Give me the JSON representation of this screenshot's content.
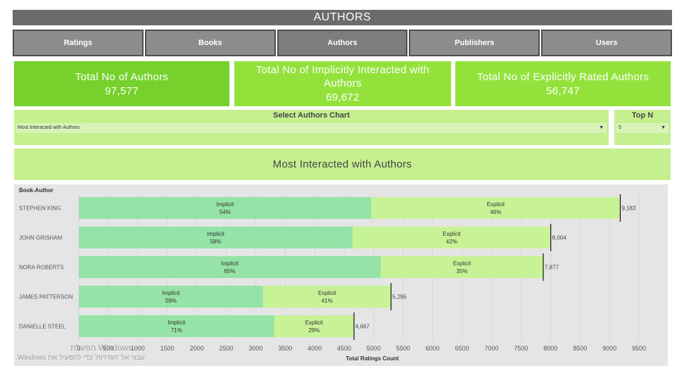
{
  "header": {
    "title": "AUTHORS"
  },
  "nav": {
    "tabs": [
      {
        "label": "Ratings"
      },
      {
        "label": "Books"
      },
      {
        "label": "Authors"
      },
      {
        "label": "Publishers"
      },
      {
        "label": "Users"
      }
    ]
  },
  "kpis": [
    {
      "label": "Total No of Authors",
      "value": "97,577"
    },
    {
      "label": "Total No of Implicitly Interacted with Authors",
      "value": "69,672"
    },
    {
      "label": "Total No of Explicitly Rated Authors",
      "value": "56,747"
    }
  ],
  "selector": {
    "label": "Select Authors Chart",
    "value": "Most Interacted with Authors"
  },
  "topn": {
    "label": "Top N",
    "value": "5"
  },
  "chart_title": "Most Interacted with Authors",
  "chart_data": {
    "type": "bar",
    "orientation": "horizontal",
    "stacked": true,
    "ylabel": "Book-Author",
    "xlabel": "Total Ratings Count",
    "categories": [
      "STEPHEN KING",
      "JOHN GRISHAM",
      "NORA ROBERTS",
      "JAMES PATTERSON",
      "DANIELLE STEEL"
    ],
    "totals": [
      9183,
      8004,
      7877,
      5295,
      4667
    ],
    "total_labels": [
      "9,183",
      "8,004",
      "7,877",
      "5,295",
      "4,667"
    ],
    "series": [
      {
        "name": "Implicit",
        "percent_labels": [
          "54%",
          "58%",
          "65%",
          "59%",
          "71%"
        ],
        "shares": [
          0.54,
          0.58,
          0.65,
          0.59,
          0.71
        ],
        "color": "#95e3a6"
      },
      {
        "name": "Explicit",
        "percent_labels": [
          "46%",
          "42%",
          "35%",
          "41%",
          "29%"
        ],
        "shares": [
          0.46,
          0.42,
          0.35,
          0.41,
          0.29
        ],
        "color": "#c8f296"
      }
    ],
    "xticks": [
      "0",
      "500",
      "1000",
      "1500",
      "2000",
      "2500",
      "3000",
      "3500",
      "4000",
      "4500",
      "5000",
      "5500",
      "6000",
      "6500",
      "7000",
      "7500",
      "8000",
      "8500",
      "9000",
      "9500"
    ],
    "xlim": [
      0,
      10000
    ],
    "grid": true,
    "colors": {
      "background": "#e5e5e5",
      "gridline": "#cfcfcf"
    }
  },
  "watermark": {
    "line1": "Windows הפעלת",
    "line2": "עבור אל 'הגדרות' כדי להפעיל את Windows."
  }
}
